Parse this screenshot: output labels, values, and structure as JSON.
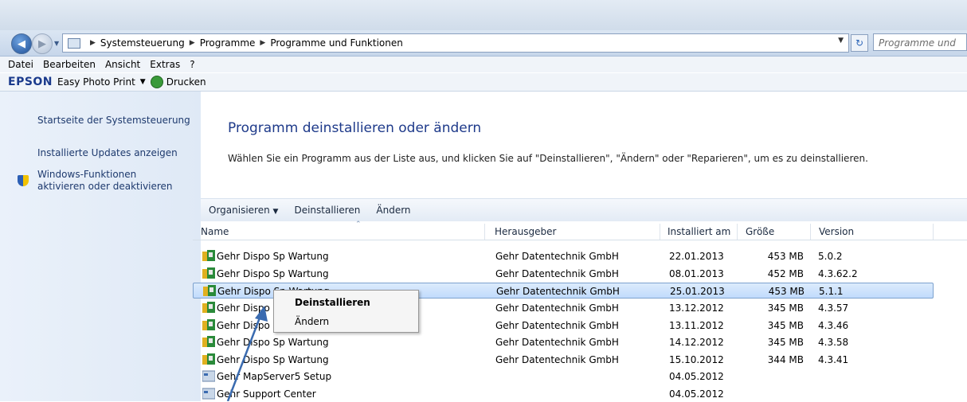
{
  "address": {
    "crumbs": [
      "Systemsteuerung",
      "Programme",
      "Programme und Funktionen"
    ],
    "search_placeholder": "Programme und"
  },
  "menubar": [
    "Datei",
    "Bearbeiten",
    "Ansicht",
    "Extras",
    "?"
  ],
  "toolbar2": {
    "brand": "EPSON",
    "app": "Easy Photo Print",
    "print": "Drucken"
  },
  "sidebar": {
    "home": "Startseite der Systemsteuerung",
    "updates": "Installierte Updates anzeigen",
    "features_line1": "Windows-Funktionen",
    "features_line2": "aktivieren oder deaktivieren"
  },
  "main": {
    "heading": "Programm deinstallieren oder ändern",
    "description": "Wählen Sie ein Programm aus der Liste aus, und klicken Sie auf \"Deinstallieren\", \"Ändern\" oder \"Reparieren\", um es zu deinstallieren.",
    "commands": {
      "organize": "Organisieren",
      "uninstall": "Deinstallieren",
      "change": "Ändern"
    }
  },
  "columns": {
    "name": "Name",
    "publisher": "Herausgeber",
    "installed": "Installiert am",
    "size": "Größe",
    "version": "Version"
  },
  "rows": [
    {
      "name": "Gehr Dispo Sp Wartung",
      "publisher": "Gehr Datentechnik GmbH",
      "installed": "22.01.2013",
      "size": "453 MB",
      "version": "5.0.2"
    },
    {
      "name": "Gehr Dispo Sp Wartung",
      "publisher": "Gehr Datentechnik GmbH",
      "installed": "08.01.2013",
      "size": "452 MB",
      "version": "4.3.62.2"
    },
    {
      "name": "Gehr Dispo Sp Wartung",
      "publisher": "Gehr Datentechnik GmbH",
      "installed": "25.01.2013",
      "size": "453 MB",
      "version": "5.1.1"
    },
    {
      "name": "Gehr Dispo Sp Wartung",
      "publisher": "Gehr Datentechnik GmbH",
      "installed": "13.12.2012",
      "size": "345 MB",
      "version": "4.3.57"
    },
    {
      "name": "Gehr Dispo Sp Wartung",
      "publisher": "Gehr Datentechnik GmbH",
      "installed": "13.11.2012",
      "size": "345 MB",
      "version": "4.3.46"
    },
    {
      "name": "Gehr Dispo Sp Wartung",
      "publisher": "Gehr Datentechnik GmbH",
      "installed": "14.12.2012",
      "size": "345 MB",
      "version": "4.3.58"
    },
    {
      "name": "Gehr Dispo Sp Wartung",
      "publisher": "Gehr Datentechnik GmbH",
      "installed": "15.10.2012",
      "size": "344 MB",
      "version": "4.3.41"
    },
    {
      "name": "Gehr MapServer5 Setup",
      "publisher": "",
      "installed": "04.05.2012",
      "size": "",
      "version": ""
    },
    {
      "name": "Gehr Support Center",
      "publisher": "",
      "installed": "04.05.2012",
      "size": "",
      "version": ""
    }
  ],
  "context_menu": {
    "uninstall": "Deinstallieren",
    "change": "Ändern"
  }
}
